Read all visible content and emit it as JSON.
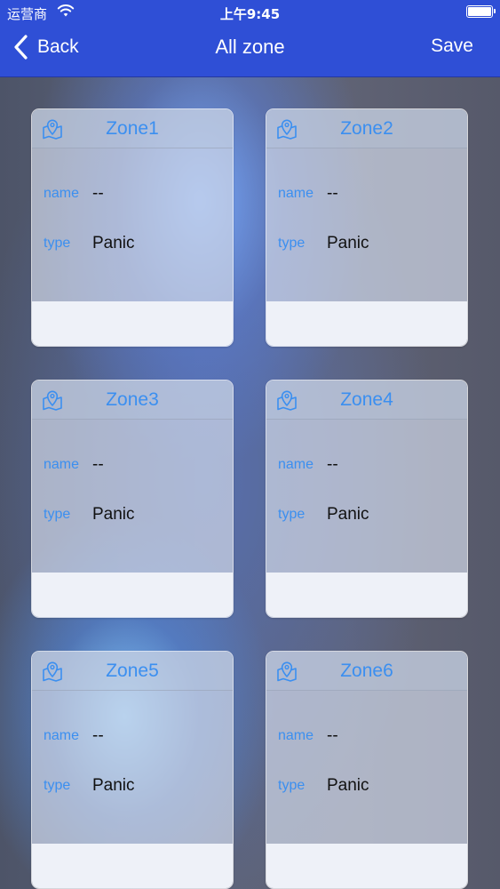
{
  "status_bar": {
    "carrier": "运营商",
    "time": "上午9:45"
  },
  "nav": {
    "back_label": "Back",
    "title": "All zone",
    "save_label": "Save"
  },
  "zones": [
    {
      "title": "Zone1",
      "name_label": "name",
      "name_value": "--",
      "type_label": "type",
      "type_value": "Panic"
    },
    {
      "title": "Zone2",
      "name_label": "name",
      "name_value": "--",
      "type_label": "type",
      "type_value": "Panic"
    },
    {
      "title": "Zone3",
      "name_label": "name",
      "name_value": "--",
      "type_label": "type",
      "type_value": "Panic"
    },
    {
      "title": "Zone4",
      "name_label": "name",
      "name_value": "--",
      "type_label": "type",
      "type_value": "Panic"
    },
    {
      "title": "Zone5",
      "name_label": "name",
      "name_value": "--",
      "type_label": "type",
      "type_value": "Panic"
    },
    {
      "title": "Zone6",
      "name_label": "name",
      "name_value": "--",
      "type_label": "type",
      "type_value": "Panic"
    }
  ],
  "icons": {
    "zone": "map-pin-icon",
    "back": "chevron-left-icon",
    "wifi": "wifi-icon",
    "battery": "battery-icon"
  },
  "colors": {
    "nav_background": "#2f4fd6",
    "accent": "#3b8ff0",
    "value_text": "#111111"
  }
}
